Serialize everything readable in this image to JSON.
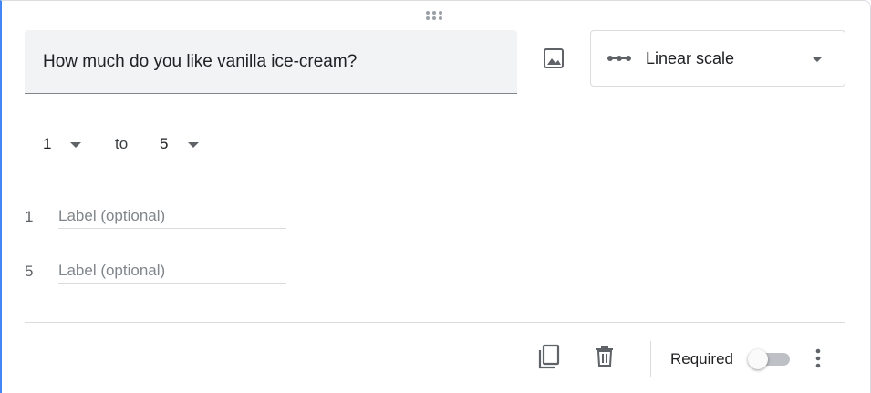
{
  "question": {
    "title": "How much do you like vanilla ice-cream?"
  },
  "type_select": {
    "label": "Linear scale",
    "icon": "linear-scale-icon"
  },
  "scale": {
    "min_value": "1",
    "to_text": "to",
    "max_value": "5"
  },
  "labels": [
    {
      "number": "1",
      "placeholder": "Label (optional)",
      "value": ""
    },
    {
      "number": "5",
      "placeholder": "Label (optional)",
      "value": ""
    }
  ],
  "footer": {
    "duplicate_icon": "copy-icon",
    "delete_icon": "trash-icon",
    "required_label": "Required",
    "required_on": false,
    "more_icon": "more-vert-icon"
  },
  "colors": {
    "accent": "#4285f4",
    "icon": "#5f6368",
    "field_bg": "#f1f3f4"
  }
}
